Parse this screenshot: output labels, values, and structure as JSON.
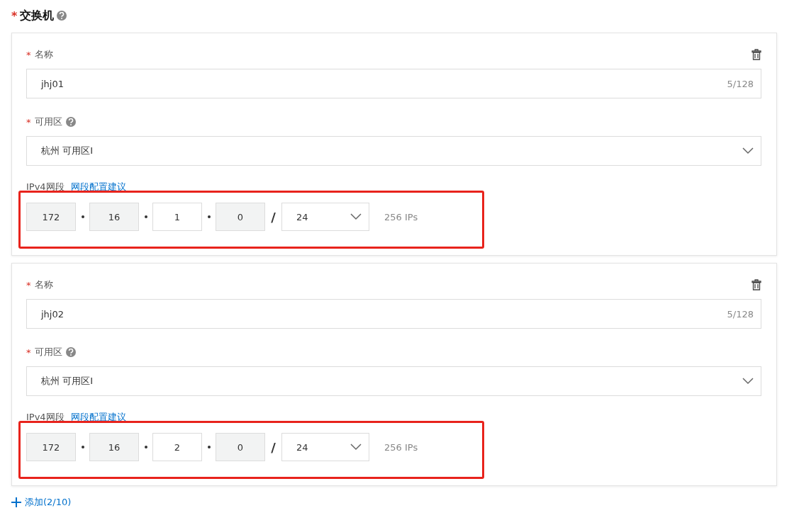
{
  "section": {
    "mark": "*",
    "title": "交换机"
  },
  "switches": [
    {
      "name_mark": "*",
      "name_label": "名称",
      "name_value": "jhj01",
      "name_count": "5/128",
      "zone_mark": "*",
      "zone_label": "可用区",
      "zone_value": "杭州 可用区I",
      "cidr_label": "IPv4网段",
      "cidr_link": "网段配置建议",
      "octets": [
        {
          "value": "172",
          "disabled": true
        },
        {
          "value": "16",
          "disabled": true
        },
        {
          "value": "1",
          "disabled": false
        },
        {
          "value": "0",
          "disabled": true
        }
      ],
      "slash": "/",
      "prefix": "24",
      "ip_count": "256 IPs",
      "highlighted": true
    },
    {
      "name_mark": "*",
      "name_label": "名称",
      "name_value": "jhj02",
      "name_count": "5/128",
      "zone_mark": "*",
      "zone_label": "可用区",
      "zone_value": "杭州 可用区I",
      "cidr_label": "IPv4网段",
      "cidr_link": "网段配置建议",
      "octets": [
        {
          "value": "172",
          "disabled": true
        },
        {
          "value": "16",
          "disabled": true
        },
        {
          "value": "2",
          "disabled": false
        },
        {
          "value": "0",
          "disabled": true
        }
      ],
      "slash": "/",
      "prefix": "24",
      "ip_count": "256 IPs",
      "highlighted": true
    }
  ],
  "add_button": {
    "label": "添加(2/10)"
  }
}
